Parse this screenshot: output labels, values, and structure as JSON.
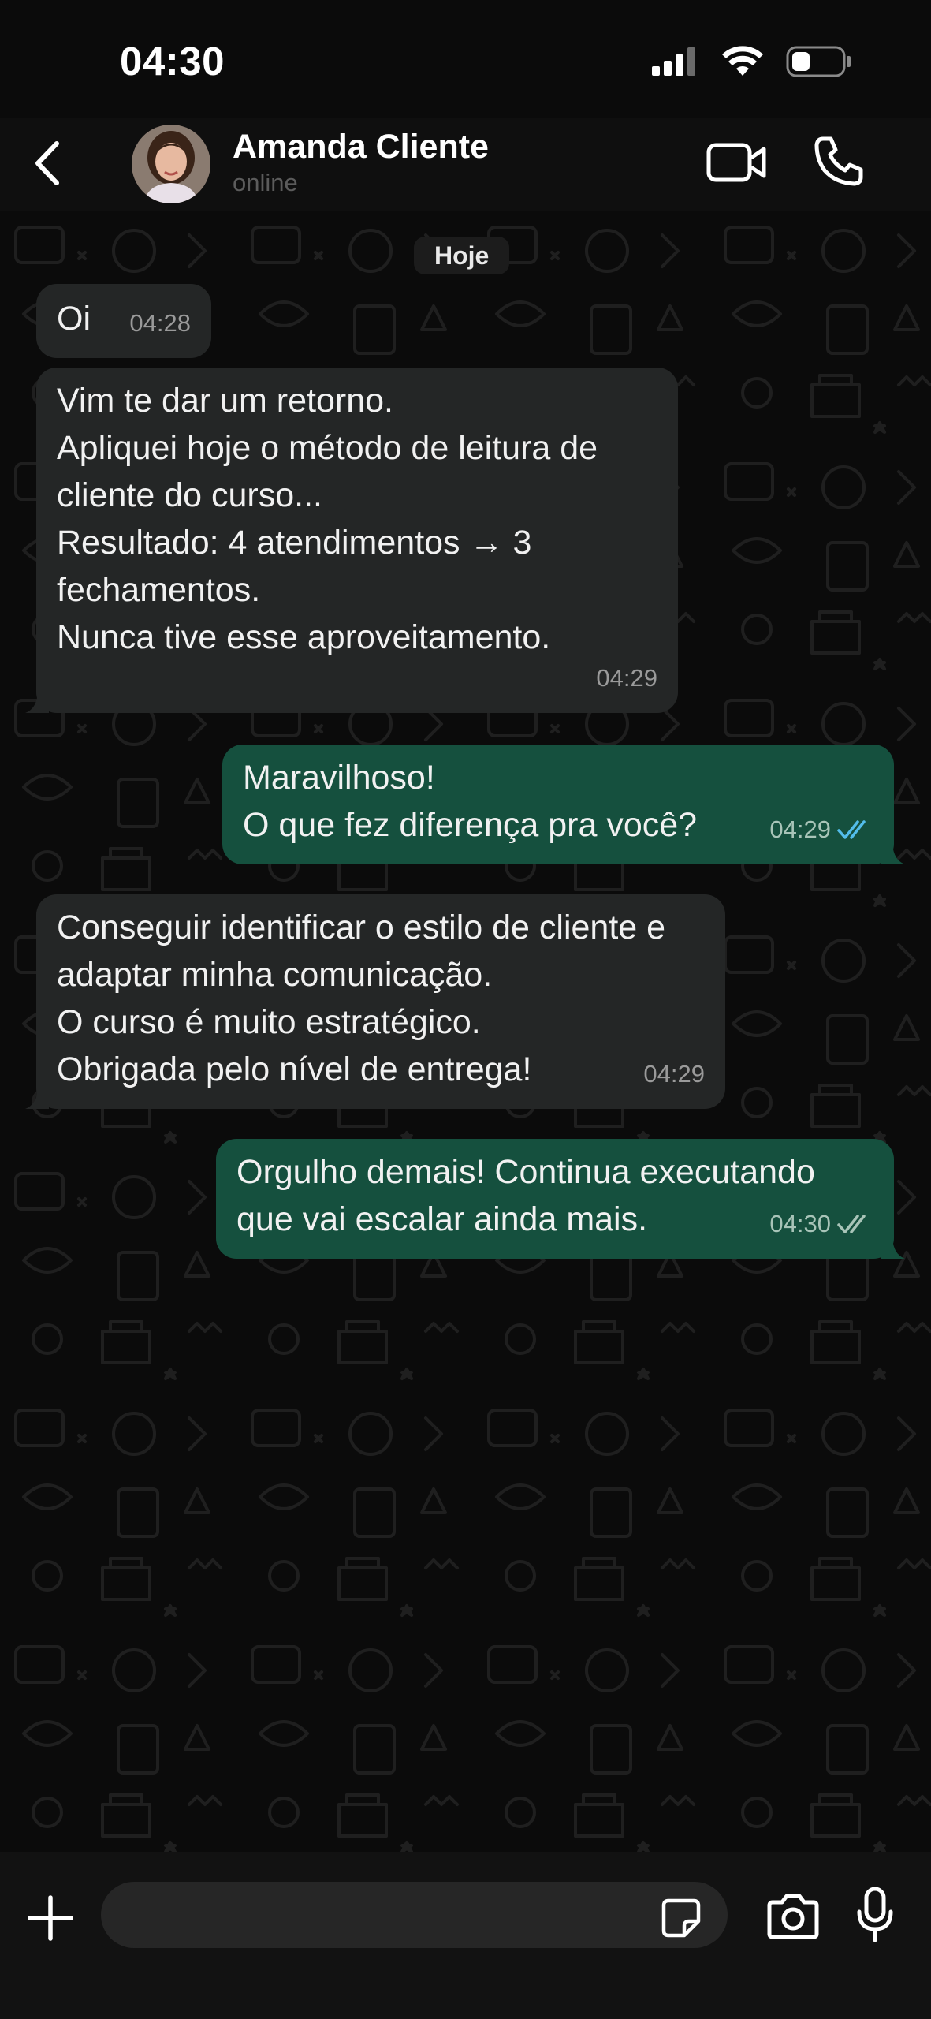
{
  "status_bar": {
    "time": "04:30"
  },
  "header": {
    "contact_name": "Amanda Cliente",
    "contact_status": "online"
  },
  "chat": {
    "date_chip": "Hoje",
    "messages": [
      {
        "direction": "in",
        "text": "Oi",
        "time": "04:28"
      },
      {
        "direction": "in",
        "text": "Vim te dar um retorno.\nApliquei hoje o método de leitura de cliente do curso...\nResultado: 4 atendimentos → 3 fechamentos.\nNunca tive esse aproveitamento.",
        "time": "04:29"
      },
      {
        "direction": "out",
        "text": "Maravilhoso!\nO que fez diferença pra você?",
        "time": "04:29",
        "read_status": "read"
      },
      {
        "direction": "in",
        "text": "Conseguir identificar o estilo de cliente e adaptar minha comunicação.\nO curso é muito estratégico.\nObrigada pelo nível de entrega!",
        "time": "04:29"
      },
      {
        "direction": "out",
        "text": "Orgulho demais! Continua executando que vai escalar ainda mais.",
        "time": "04:30",
        "read_status": "delivered"
      }
    ]
  },
  "input": {
    "placeholder": ""
  },
  "icons": {
    "back": "chevron-left-icon",
    "video": "video-camera-icon",
    "call": "phone-icon",
    "plus": "plus-icon",
    "sticker": "sticker-icon",
    "camera": "camera-icon",
    "mic": "microphone-icon"
  },
  "colors": {
    "background": "#0b0b0b",
    "incoming_bubble": "#242626",
    "outgoing_bubble": "#15503e",
    "read_ticks": "#53bdeb",
    "delivered_ticks": "#a8c4b8"
  }
}
